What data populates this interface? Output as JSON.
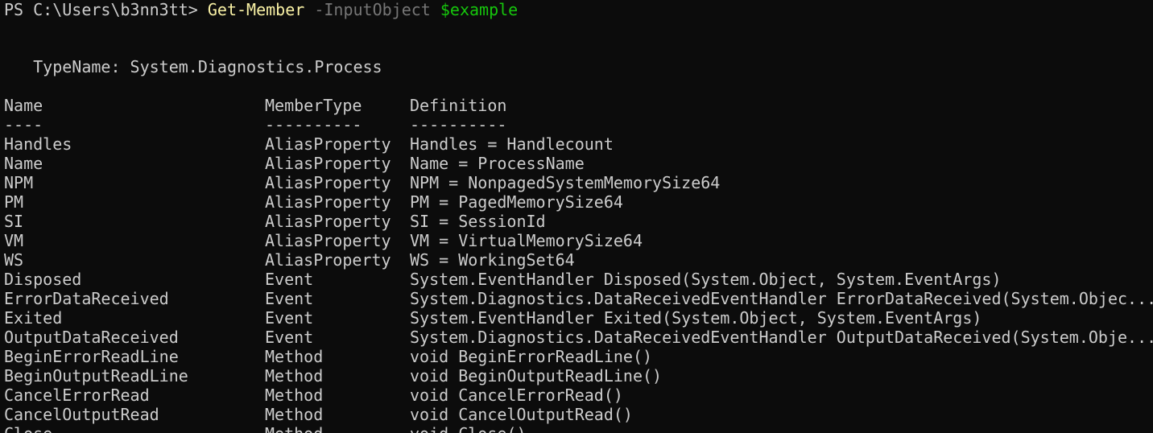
{
  "prompt": {
    "prefix": "PS C:\\Users\\b3nn3tt> ",
    "command": "Get-Member",
    "parameter": "-InputObject",
    "variable": "$example"
  },
  "typename": "   TypeName: System.Diagnostics.Process",
  "columns": {
    "name": "Name",
    "member_type": "MemberType",
    "definition": "Definition"
  },
  "separators": {
    "name": "----",
    "member_type": "----------",
    "definition": "----------"
  },
  "members": [
    {
      "name": "Handles",
      "type": "AliasProperty",
      "definition": "Handles = Handlecount"
    },
    {
      "name": "Name",
      "type": "AliasProperty",
      "definition": "Name = ProcessName"
    },
    {
      "name": "NPM",
      "type": "AliasProperty",
      "definition": "NPM = NonpagedSystemMemorySize64"
    },
    {
      "name": "PM",
      "type": "AliasProperty",
      "definition": "PM = PagedMemorySize64"
    },
    {
      "name": "SI",
      "type": "AliasProperty",
      "definition": "SI = SessionId"
    },
    {
      "name": "VM",
      "type": "AliasProperty",
      "definition": "VM = VirtualMemorySize64"
    },
    {
      "name": "WS",
      "type": "AliasProperty",
      "definition": "WS = WorkingSet64"
    },
    {
      "name": "Disposed",
      "type": "Event",
      "definition": "System.EventHandler Disposed(System.Object, System.EventArgs)"
    },
    {
      "name": "ErrorDataReceived",
      "type": "Event",
      "definition": "System.Diagnostics.DataReceivedEventHandler ErrorDataReceived(System.Objec..."
    },
    {
      "name": "Exited",
      "type": "Event",
      "definition": "System.EventHandler Exited(System.Object, System.EventArgs)"
    },
    {
      "name": "OutputDataReceived",
      "type": "Event",
      "definition": "System.Diagnostics.DataReceivedEventHandler OutputDataReceived(System.Obje..."
    },
    {
      "name": "BeginErrorReadLine",
      "type": "Method",
      "definition": "void BeginErrorReadLine()"
    },
    {
      "name": "BeginOutputReadLine",
      "type": "Method",
      "definition": "void BeginOutputReadLine()"
    },
    {
      "name": "CancelErrorRead",
      "type": "Method",
      "definition": "void CancelErrorRead()"
    },
    {
      "name": "CancelOutputRead",
      "type": "Method",
      "definition": "void CancelOutputRead()"
    },
    {
      "name": "Close",
      "type": "Method",
      "definition": "void Close()"
    }
  ],
  "colors": {
    "background": "#0c0c0c",
    "foreground": "#cccccc",
    "command": "#f9f1a5",
    "parameter": "#767676",
    "variable": "#16c60c"
  }
}
